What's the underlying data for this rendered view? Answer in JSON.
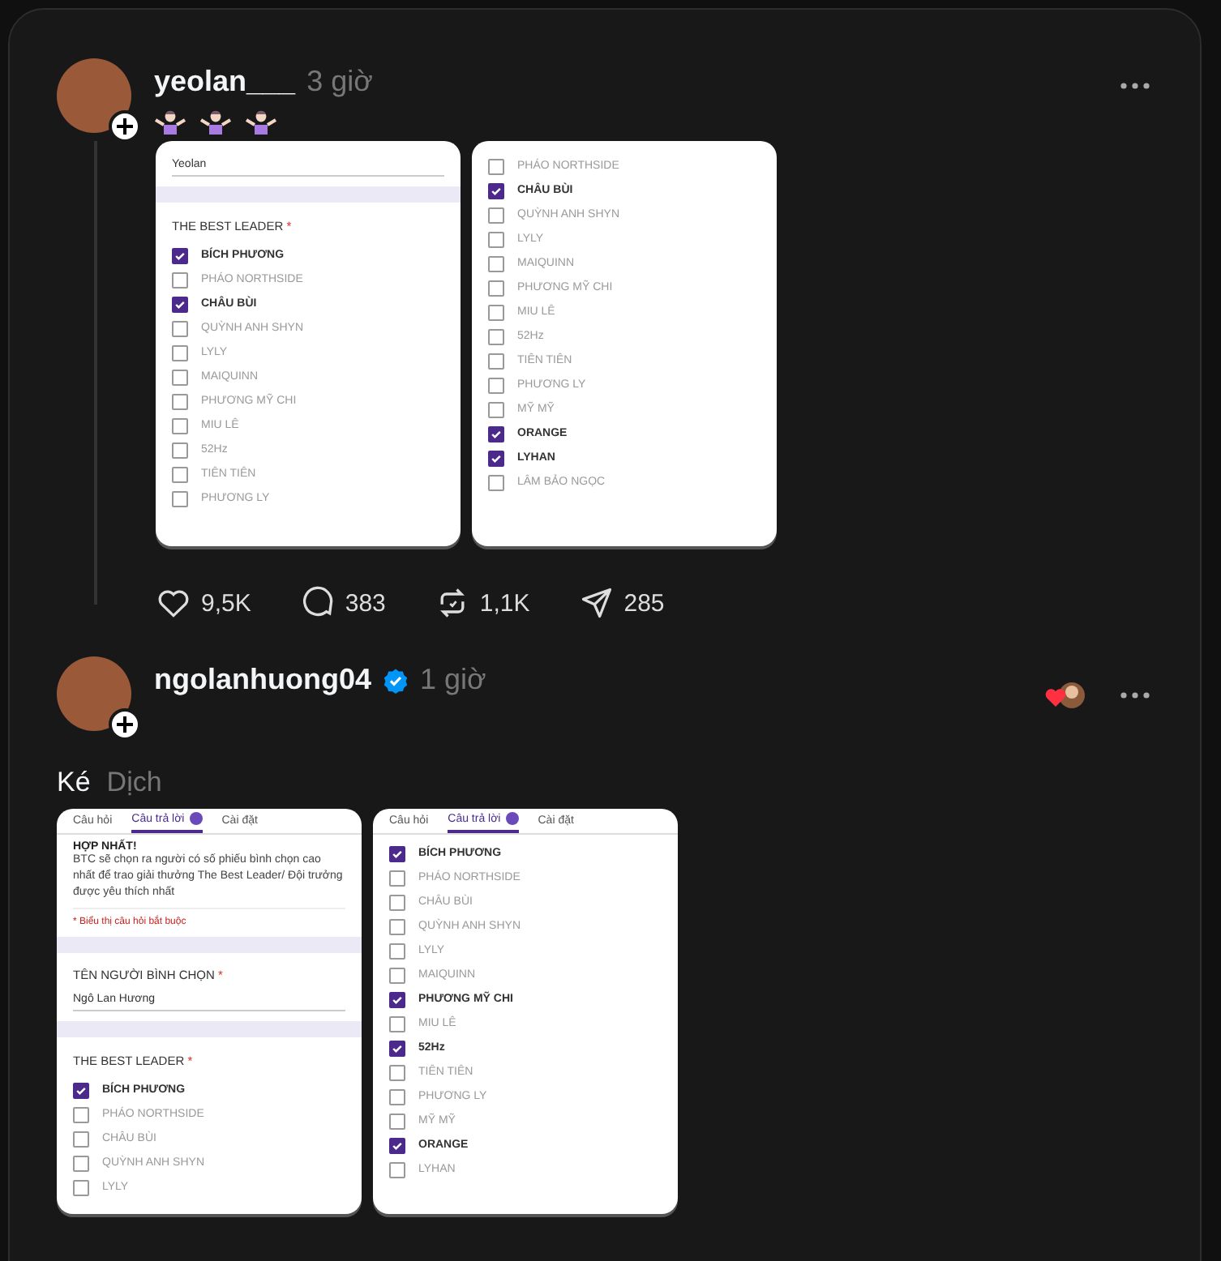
{
  "posts": [
    {
      "username": "yeolan___",
      "time": "3 giờ",
      "screenshots": [
        {
          "blocks": [
            {
              "kind": "value",
              "label": "Yeolan"
            },
            {
              "kind": "break"
            },
            {
              "kind": "question",
              "label": "THE BEST LEADER",
              "mark": "*"
            },
            {
              "kind": "option",
              "label": "BÍCH PHƯƠNG",
              "checked": true
            },
            {
              "kind": "option",
              "label": "PHÁO NORTHSIDE",
              "checked": false
            },
            {
              "kind": "option",
              "label": "CHÂU BÙI",
              "checked": true
            },
            {
              "kind": "option",
              "label": "QUỲNH ANH SHYN",
              "checked": false
            },
            {
              "kind": "option",
              "label": "LYLY",
              "checked": false
            },
            {
              "kind": "option",
              "label": "MAIQUINN",
              "checked": false
            },
            {
              "kind": "option",
              "label": "PHƯƠNG MỸ CHI",
              "checked": false
            },
            {
              "kind": "option",
              "label": "MIU LÊ",
              "checked": false
            },
            {
              "kind": "option",
              "label": "52Hz",
              "checked": false
            },
            {
              "kind": "option",
              "label": "TIÊN TIÊN",
              "checked": false
            },
            {
              "kind": "option",
              "label": "PHƯƠNG LY",
              "checked": false
            }
          ]
        },
        {
          "blocks": [
            {
              "kind": "option",
              "label": "PHÁO NORTHSIDE",
              "checked": false
            },
            {
              "kind": "option",
              "label": "CHÂU BÙI",
              "checked": true
            },
            {
              "kind": "option",
              "label": "QUỲNH ANH SHYN",
              "checked": false
            },
            {
              "kind": "option",
              "label": "LYLY",
              "checked": false
            },
            {
              "kind": "option",
              "label": "MAIQUINN",
              "checked": false
            },
            {
              "kind": "option",
              "label": "PHƯƠNG MỸ CHI",
              "checked": false
            },
            {
              "kind": "option",
              "label": "MIU LÊ",
              "checked": false
            },
            {
              "kind": "option",
              "label": "52Hz",
              "checked": false
            },
            {
              "kind": "option",
              "label": "TIÊN TIÊN",
              "checked": false
            },
            {
              "kind": "option",
              "label": "PHƯƠNG LY",
              "checked": false
            },
            {
              "kind": "option",
              "label": "MỸ MỸ",
              "checked": false
            },
            {
              "kind": "option",
              "label": "ORANGE",
              "checked": true
            },
            {
              "kind": "option",
              "label": "LYHAN",
              "checked": true
            },
            {
              "kind": "option",
              "label": "LÂM BẢO NGỌC",
              "checked": false
            }
          ]
        }
      ],
      "actions": [
        "9,5K",
        "383",
        "1,1K",
        "285"
      ]
    },
    {
      "username": "ngolanhuong04",
      "time": "1 giờ",
      "verified": true,
      "reactions": [
        {
          "kind": "heart"
        }
      ],
      "text": "Ké",
      "translate": "Dịch",
      "screenshots": [
        {
          "tabs": [
            {
              "label": "Câu hỏi",
              "selected": false
            },
            {
              "label": "Câu trả lời",
              "selected": true
            },
            {
              "label": "Cài đặt",
              "selected": false
            }
          ],
          "blocks": [
            {
              "kind": "heading",
              "label": "HỢP NHẤT!"
            },
            {
              "kind": "description",
              "label": "BTC sẽ chọn ra người có số phiếu bình chọn cao nhất để trao giải thưởng The Best Leader/ Đội trưởng được yêu thích nhất"
            },
            {
              "kind": "note",
              "label": "* Biểu thị câu hỏi bắt buộc"
            },
            {
              "kind": "break"
            },
            {
              "kind": "field",
              "label": "TÊN NGƯỜI BÌNH CHỌN",
              "mark": "*"
            },
            {
              "kind": "value",
              "label": "Ngô Lan Hương"
            },
            {
              "kind": "break"
            },
            {
              "kind": "question",
              "label": "THE BEST LEADER",
              "mark": "*"
            },
            {
              "kind": "option",
              "label": "BÍCH PHƯƠNG",
              "checked": true
            },
            {
              "kind": "option",
              "label": "PHÁO NORTHSIDE",
              "checked": false
            },
            {
              "kind": "option",
              "label": "CHÂU BÙI",
              "checked": false
            },
            {
              "kind": "option",
              "label": "QUỲNH ANH SHYN",
              "checked": false
            },
            {
              "kind": "option",
              "label": "LYLY",
              "checked": false
            }
          ]
        },
        {
          "tabs": [
            {
              "label": "Câu hỏi",
              "selected": false
            },
            {
              "label": "Câu trả lời",
              "selected": true
            },
            {
              "label": "Cài đặt",
              "selected": false
            }
          ],
          "blocks": [
            {
              "kind": "option",
              "label": "BÍCH PHƯƠNG",
              "checked": true
            },
            {
              "kind": "option",
              "label": "PHÁO NORTHSIDE",
              "checked": false
            },
            {
              "kind": "option",
              "label": "CHÂU BÙI",
              "checked": false
            },
            {
              "kind": "option",
              "label": "QUỲNH ANH SHYN",
              "checked": false
            },
            {
              "kind": "option",
              "label": "LYLY",
              "checked": false
            },
            {
              "kind": "option",
              "label": "MAIQUINN",
              "checked": false
            },
            {
              "kind": "option",
              "label": "PHƯƠNG MỸ CHI",
              "checked": true
            },
            {
              "kind": "option",
              "label": "MIU LÊ",
              "checked": false
            },
            {
              "kind": "option",
              "label": "52Hz",
              "checked": true
            },
            {
              "kind": "option",
              "label": "TIÊN TIÊN",
              "checked": false
            },
            {
              "kind": "option",
              "label": "PHƯƠNG LY",
              "checked": false
            },
            {
              "kind": "option",
              "label": "MỸ MỸ",
              "checked": false
            },
            {
              "kind": "option",
              "label": "ORANGE",
              "checked": true
            },
            {
              "kind": "option",
              "label": "LYHAN",
              "checked": false
            }
          ]
        }
      ]
    }
  ]
}
